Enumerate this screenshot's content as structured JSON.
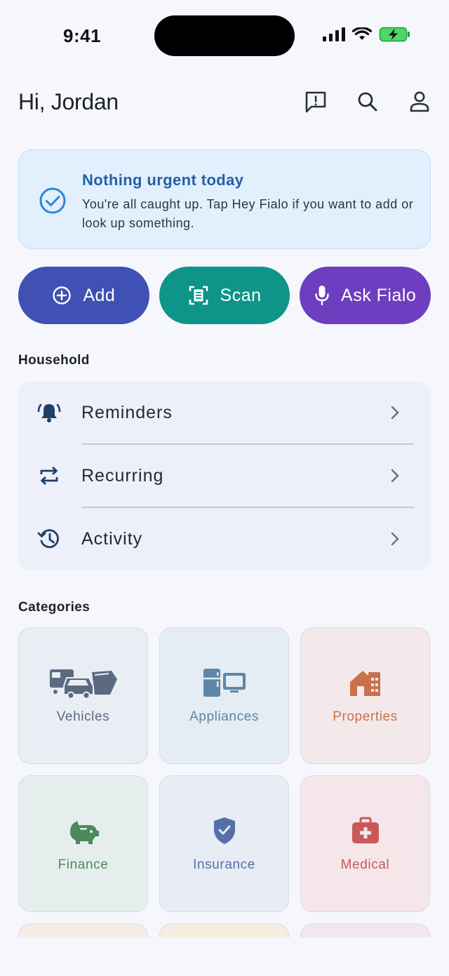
{
  "status_bar": {
    "time": "9:41"
  },
  "header": {
    "greeting": "Hi, Jordan"
  },
  "alert": {
    "title": "Nothing urgent today",
    "body": "You're all caught up. Tap Hey Fialo if you want to add or look up something."
  },
  "actions": {
    "add": "Add",
    "scan": "Scan",
    "ask": "Ask Fialo"
  },
  "household": {
    "title": "Household",
    "items": [
      {
        "label": "Reminders",
        "icon": "bell-ring-icon"
      },
      {
        "label": "Recurring",
        "icon": "repeat-icon"
      },
      {
        "label": "Activity",
        "icon": "history-icon"
      }
    ]
  },
  "categories": {
    "title": "Categories",
    "items": [
      {
        "label": "Vehicles",
        "icon": "vehicles-icon",
        "color": "#5b6a80",
        "bg": "#e9edf4"
      },
      {
        "label": "Appliances",
        "icon": "appliances-icon",
        "color": "#5d86a8",
        "bg": "#e4ecf4"
      },
      {
        "label": "Properties",
        "icon": "house-icon",
        "color": "#c7724d",
        "bg": "#f4e9ea"
      },
      {
        "label": "Finance",
        "icon": "piggy-bank-icon",
        "color": "#4c8a5c",
        "bg": "#e5eeec"
      },
      {
        "label": "Insurance",
        "icon": "shield-check-icon",
        "color": "#566fa8",
        "bg": "#e7ecf5"
      },
      {
        "label": "Medical",
        "icon": "first-aid-icon",
        "color": "#c95959",
        "bg": "#f5e6ea"
      }
    ]
  },
  "colors": {
    "add": "#3f51b5",
    "scan": "#0e9488",
    "ask": "#6d3ebf",
    "alert_bg": "#e2effd",
    "alert_title": "#2461a6"
  }
}
